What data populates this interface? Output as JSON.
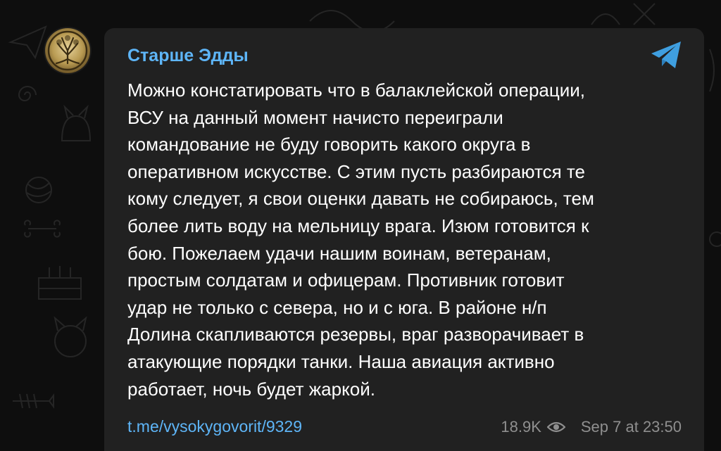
{
  "channel": {
    "name": "Старше Эдды",
    "avatar_icon": "tree-of-life-avatar-icon"
  },
  "message": {
    "lines": [
      "Можно констатировать что в балаклейской операции,",
      "ВСУ на данный момент начисто переиграли",
      "командование не буду говорить какого округа в",
      "оперативном искусстве. С этим пусть разбираются те",
      "кому следует, я свои оценки давать не собираюсь, тем",
      "более лить воду на мельницу врага. Изюм готовится к",
      "бою. Пожелаем удачи нашим воинам, ветеранам,",
      "простым солдатам и офицерам. Противник готовит",
      "удар не только с севера, но и с юга. В районе н/п",
      "Долина скапливаются резервы, враг разворачивает в",
      "атакующие порядки танки. Наша авиация активно",
      "работает, ночь будет жаркой."
    ],
    "link": "t.me/vysokygovorit/9329",
    "views": "18.9K",
    "views_icon": "eye-icon",
    "timestamp": "Sep 7 at 23:50",
    "share_icon": "telegram-share-icon"
  },
  "colors": {
    "background": "#0e0e0e",
    "bubble": "#212121",
    "accent": "#5eb5f7",
    "text": "#ffffff",
    "meta": "#8f8f8f"
  }
}
